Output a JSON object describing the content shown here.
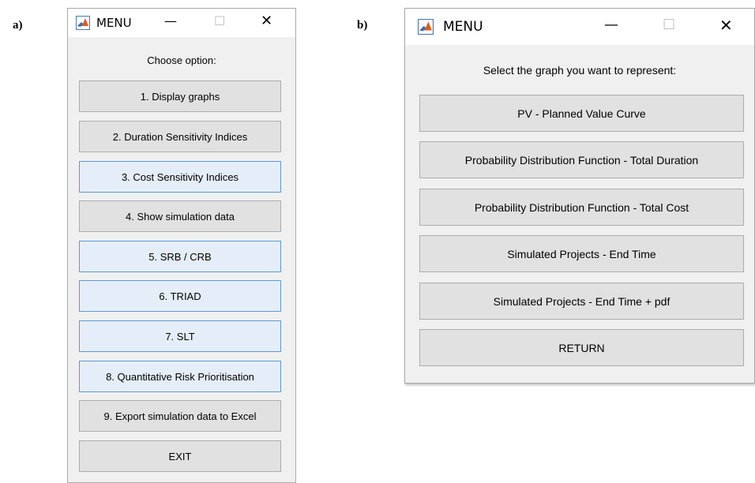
{
  "panels": {
    "a": "a)",
    "b": "b)"
  },
  "window_a": {
    "title": "MENU",
    "prompt": "Choose option:",
    "buttons": [
      "1. Display graphs",
      "2. Duration Sensitivity Indices",
      "3. Cost Sensitivity Indices",
      "4. Show simulation data",
      "5. SRB / CRB",
      "6. TRIAD",
      "7. SLT",
      "8. Quantitative Risk Prioritisation",
      "9. Export simulation data to Excel",
      "EXIT"
    ]
  },
  "window_b": {
    "title": "MENU",
    "prompt": "Select the graph you want to represent:",
    "buttons": [
      "PV - Planned Value Curve",
      "Probability Distribution Function - Total Duration",
      "Probability Distribution Function - Total Cost",
      "Simulated Projects - End Time",
      "Simulated Projects - End Time + pdf",
      "RETURN"
    ]
  },
  "controls": {
    "minimize": "—",
    "maximize": "☐",
    "close": "✕"
  },
  "icons": {
    "app": "matlab-icon"
  }
}
